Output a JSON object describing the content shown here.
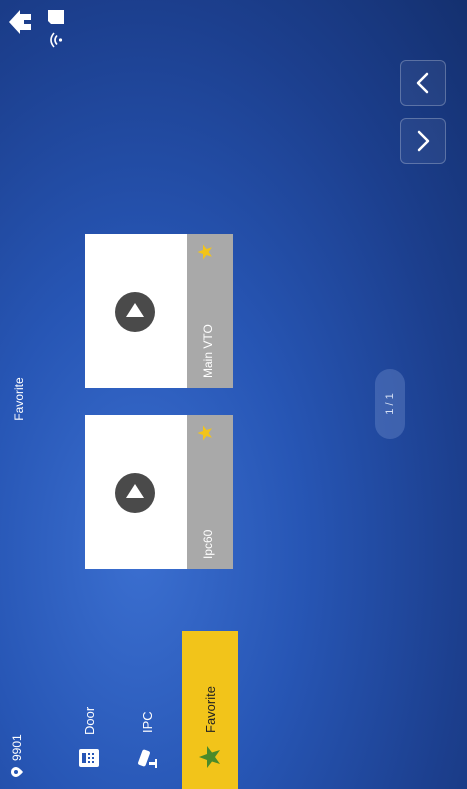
{
  "header": {
    "device_id": "9901",
    "title": "Favorite"
  },
  "sidebar": {
    "items": [
      {
        "label": "Door",
        "icon": "door-icon"
      },
      {
        "label": "IPC",
        "icon": "camera-icon"
      },
      {
        "label": "Favorite",
        "icon": "star-icon",
        "active": true
      }
    ]
  },
  "cards": [
    {
      "label": "Ipc60",
      "icon": "play-icon",
      "favorite": true
    },
    {
      "label": "Main VTO",
      "icon": "play-icon",
      "favorite": true
    }
  ],
  "pagination": {
    "text": "1 / 1"
  },
  "colors": {
    "accent": "#f2c41a",
    "background": "#2756b5",
    "tile_footer": "#a9a9a9"
  }
}
